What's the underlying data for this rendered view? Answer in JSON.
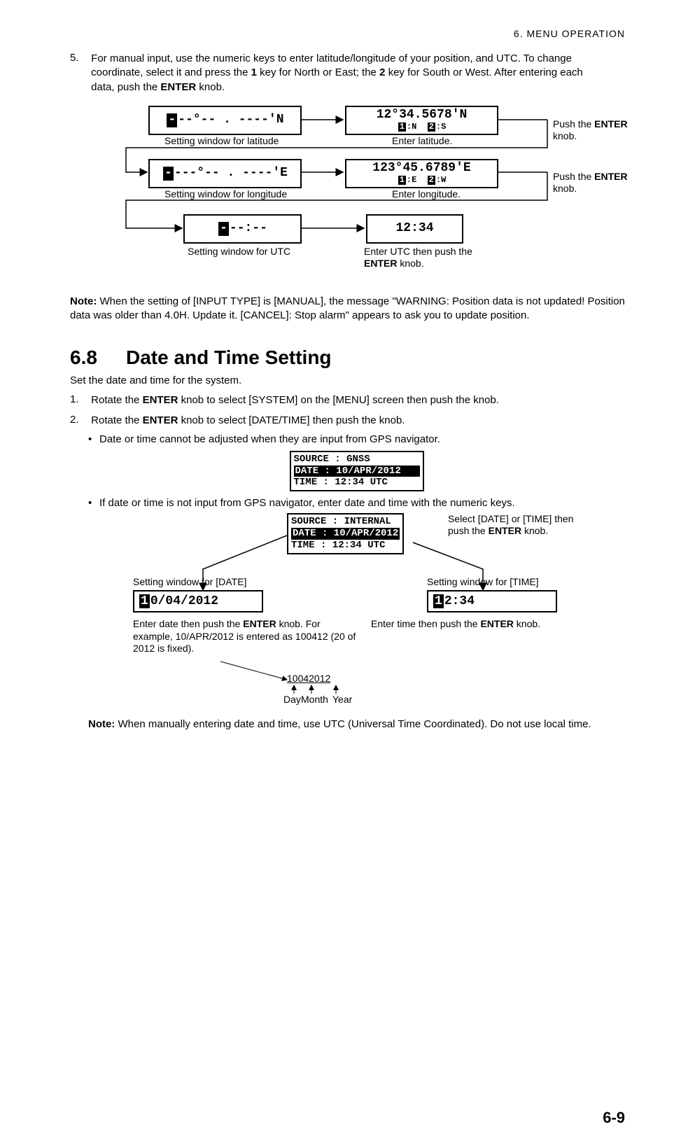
{
  "header": {
    "chapter": "6.  MENU OPERATION"
  },
  "footer": {
    "pagenum": "6-9"
  },
  "step5": {
    "num": "5.",
    "text_a": "For manual input, use the numeric keys to enter latitude/longitude of your position, and UTC. To change coordinate, select it and press the ",
    "key1": "1",
    "text_b": " key for North or East; the ",
    "key2": "2",
    "text_c": " key for South or West. After entering each data, push the ",
    "enter": "ENTER",
    "text_d": " knob."
  },
  "fig1": {
    "lat_blank": "--°-- . ----'N",
    "lat_filled_line1": "12°34.5678'N",
    "lat_filled_line2_a": "1",
    "lat_filled_line2_b": ":N",
    "lat_filled_line2_c": "2",
    "lat_filled_line2_d": ":S",
    "lat_left_cap": "Setting window for latitude",
    "lat_right_cap": "Enter latitude.",
    "push_a": "Push the ",
    "push_enter": "ENTER",
    "push_b": " knob.",
    "lon_blank": "---°-- . ----'E",
    "lon_filled_line1": "123°45.6789'E",
    "lon_filled_line2_a": "1",
    "lon_filled_line2_b": ":E",
    "lon_filled_line2_c": "2",
    "lon_filled_line2_d": ":W",
    "lon_left_cap": "Setting window for longitude",
    "lon_right_cap": "Enter longitude.",
    "utc_blank": "--:--",
    "utc_filled": "12:34",
    "utc_left_cap": "Setting window for UTC",
    "utc_right_cap_a": "Enter UTC then push the ",
    "utc_right_cap_enter": "ENTER",
    "utc_right_cap_b": " knob."
  },
  "note1": {
    "bold": "Note:",
    "text": " When the setting of [INPUT TYPE] is [MANUAL], the message \"WARNING: Position data is not updated! Position data was older than 4.0H. Update it. [CANCEL]: Stop alarm\" appears to ask you to update position."
  },
  "sec68": {
    "num": "6.8",
    "title": "Date and Time Setting",
    "intro": "Set the date and time for the system.",
    "step1_n": "1.",
    "step1_a": "Rotate the ",
    "step1_enter": "ENTER",
    "step1_b": " knob to select [SYSTEM] on the [MENU] screen then push the knob.",
    "step2_n": "2.",
    "step2_a": "Rotate the ",
    "step2_enter": "ENTER",
    "step2_b": " knob to select [DATE/TIME] then push the knob.",
    "bullet1": "Date or time cannot be adjusted when they are input from GPS navigator.",
    "ss1_l1": "SOURCE : GNSS",
    "ss1_l2": " DATE : 10/APR/2012",
    "ss1_l3": " TIME : 12:34 UTC",
    "bullet2": "If date or time is not input from GPS navigator, enter date and time with the numeric keys."
  },
  "fig2": {
    "topss_l1": "SOURCE : INTERNAL",
    "topss_l2": " DATE : 10/APR/2012",
    "topss_l3": " TIME : 12:34 UTC",
    "right_top_a": "Select [DATE] or [TIME] then push the ",
    "right_top_enter": "ENTER",
    "right_top_b": " knob.",
    "left_cap": "Setting window for [DATE]",
    "right_cap": "Setting window for [TIME]",
    "date_box_pre": "1",
    "date_box": "0/04/2012",
    "time_box_pre": "1",
    "time_box": "2:34",
    "left_below_a": "Enter date then push the ",
    "left_below_enter": "ENTER",
    "left_below_b": " knob. For example, 10/APR/2012 is entered as 100412 (20 of 2012 is fixed).",
    "right_below_a": "Enter time then push the ",
    "right_below_enter": "ENTER",
    "right_below_b": " knob.",
    "annot": "10042012",
    "annot_day": "Day",
    "annot_month": "Month",
    "annot_year": "Year"
  },
  "note2": {
    "bold": "Note:",
    "text": " When manually entering date and time, use UTC (Universal Time Coordinated). Do not use local time."
  }
}
